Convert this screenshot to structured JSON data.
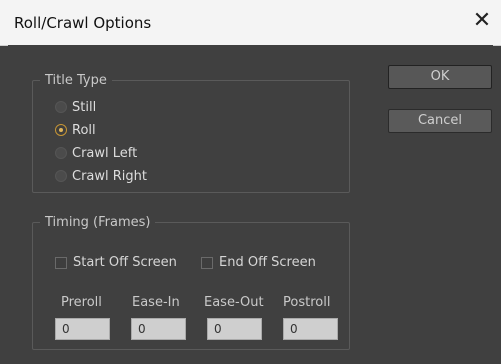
{
  "window": {
    "title": "Roll/Crawl Options",
    "close_glyph": "✕"
  },
  "title_type": {
    "legend": "Title Type",
    "options": [
      {
        "label": "Still",
        "checked": false
      },
      {
        "label": "Roll",
        "checked": true
      },
      {
        "label": "Crawl Left",
        "checked": false
      },
      {
        "label": "Crawl Right",
        "checked": false
      }
    ]
  },
  "timing": {
    "legend": "Timing (Frames)",
    "start_off_screen": {
      "label": "Start Off Screen",
      "checked": false
    },
    "end_off_screen": {
      "label": "End Off Screen",
      "checked": false
    },
    "fields": [
      {
        "label": "Preroll",
        "value": "0"
      },
      {
        "label": "Ease-In",
        "value": "0"
      },
      {
        "label": "Ease-Out",
        "value": "0"
      },
      {
        "label": "Postroll",
        "value": "0"
      }
    ]
  },
  "buttons": {
    "ok": "OK",
    "cancel": "Cancel"
  },
  "colors": {
    "accent_radio": "#c79635",
    "panel_bg": "#404040",
    "titlebar_bg": "#f4f4f4"
  }
}
